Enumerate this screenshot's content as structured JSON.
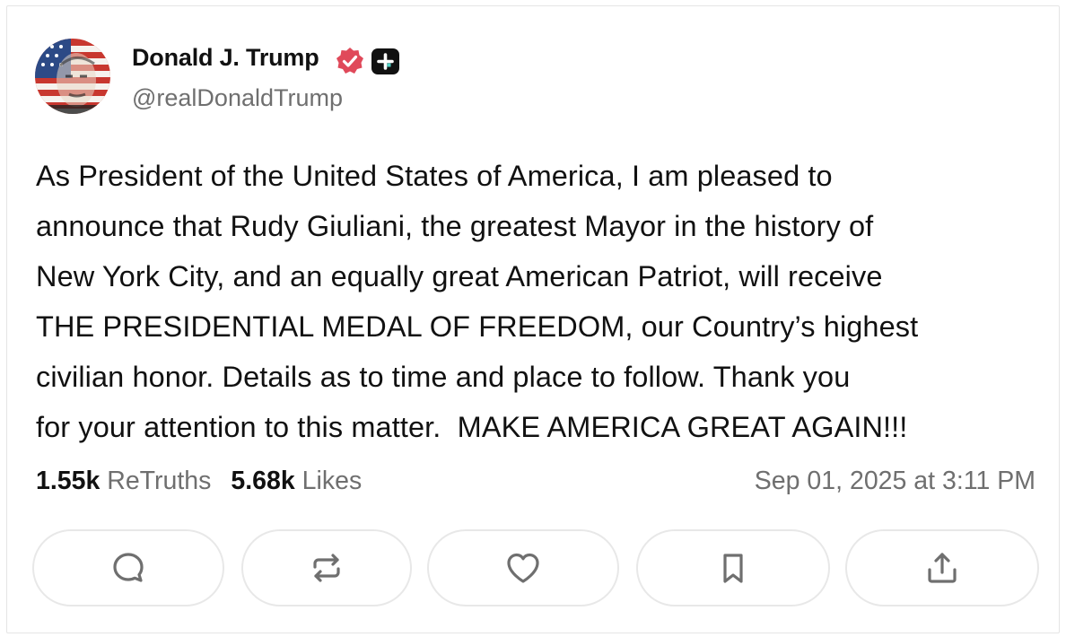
{
  "author": {
    "name": "Donald J. Trump",
    "handle": "@realDonaldTrump",
    "avatar_icon": "flag-face-avatar",
    "verified_icon": "verified-badge-icon",
    "plus_icon": "plus-badge-icon"
  },
  "post": {
    "lines": [
      "As President of the United States of America, I am pleased to",
      "announce that Rudy Giuliani, the greatest Mayor in the history of",
      "New York City, and an equally great American Patriot, will receive",
      "THE PRESIDENTIAL MEDAL OF FREEDOM, our Country’s highest",
      "civilian honor. Details as to time and place to follow. Thank you",
      "for your attention to this matter.  MAKE AMERICA GREAT AGAIN!!!"
    ]
  },
  "stats": {
    "retruths_count": "1.55k",
    "retruths_label": "ReTruths",
    "likes_count": "5.68k",
    "likes_label": "Likes",
    "timestamp": "Sep 01, 2025 at 3:11 PM"
  },
  "actions": [
    {
      "icon": "reply-icon"
    },
    {
      "icon": "retruth-icon"
    },
    {
      "icon": "heart-icon"
    },
    {
      "icon": "bookmark-icon"
    },
    {
      "icon": "share-icon"
    }
  ],
  "colors": {
    "verified": "#e0495a",
    "icon_gray": "#6f6f6f",
    "border": "#e8e8e8"
  }
}
